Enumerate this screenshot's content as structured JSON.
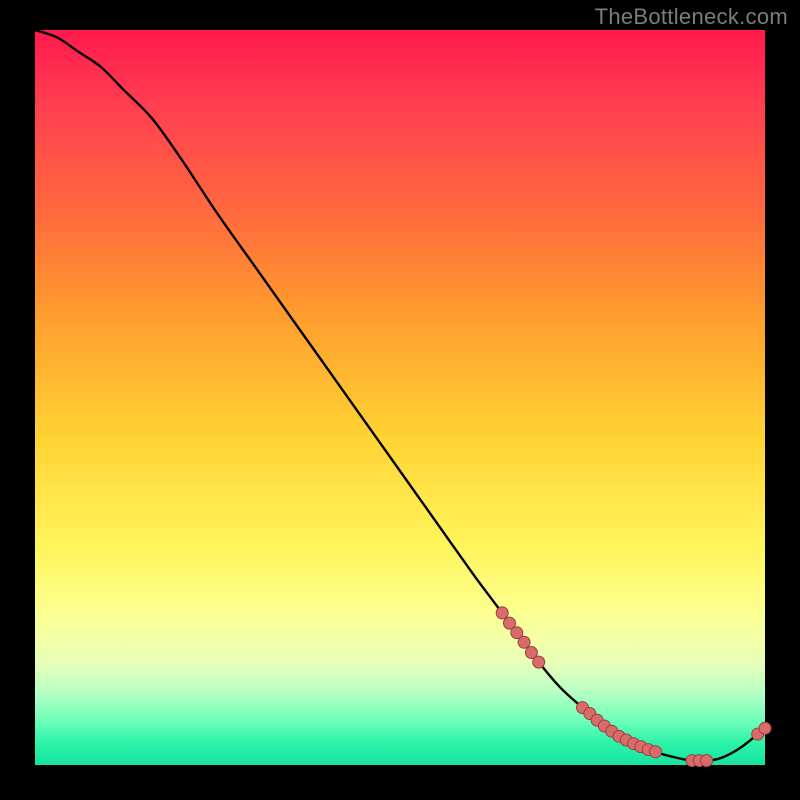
{
  "attribution": "TheBottleneck.com",
  "colors": {
    "page_bg": "#000000",
    "curve_stroke": "#000000",
    "marker_fill": "#d96b6b",
    "marker_stroke": "#9c3f3f",
    "gradient_top": "#ff1a4c",
    "gradient_bottom": "#17e39f"
  },
  "chart_data": {
    "type": "line",
    "title": "",
    "xlabel": "",
    "ylabel": "",
    "xlim": [
      0,
      100
    ],
    "ylim": [
      0,
      100
    ],
    "grid": false,
    "legend": false,
    "series": [
      {
        "name": "bottleneck-curve",
        "x": [
          0,
          3,
          6,
          9,
          12,
          16,
          20,
          25,
          30,
          35,
          40,
          45,
          50,
          55,
          60,
          63,
          66,
          69,
          72,
          75,
          78,
          81,
          84,
          87,
          90,
          93,
          95,
          97,
          99,
          100
        ],
        "y": [
          100,
          99,
          97,
          95,
          92,
          88,
          82.5,
          75,
          68,
          61,
          54,
          47,
          40,
          33,
          26,
          22,
          18,
          14,
          10.5,
          7.8,
          5.3,
          3.4,
          2.1,
          1.2,
          0.6,
          0.7,
          1.4,
          2.6,
          4.2,
          5.0
        ]
      }
    ],
    "markers": {
      "name": "highlight-points",
      "x": [
        64,
        65,
        66,
        67,
        68,
        69,
        75,
        76,
        77,
        78,
        79,
        80,
        81,
        82,
        83,
        84,
        85,
        90,
        91,
        92,
        99,
        100
      ],
      "y": [
        20.7,
        19.3,
        18.0,
        16.7,
        15.3,
        14.0,
        7.8,
        7.0,
        6.1,
        5.3,
        4.6,
        3.9,
        3.4,
        2.9,
        2.5,
        2.1,
        1.8,
        0.6,
        0.6,
        0.6,
        4.2,
        5.0
      ]
    }
  }
}
